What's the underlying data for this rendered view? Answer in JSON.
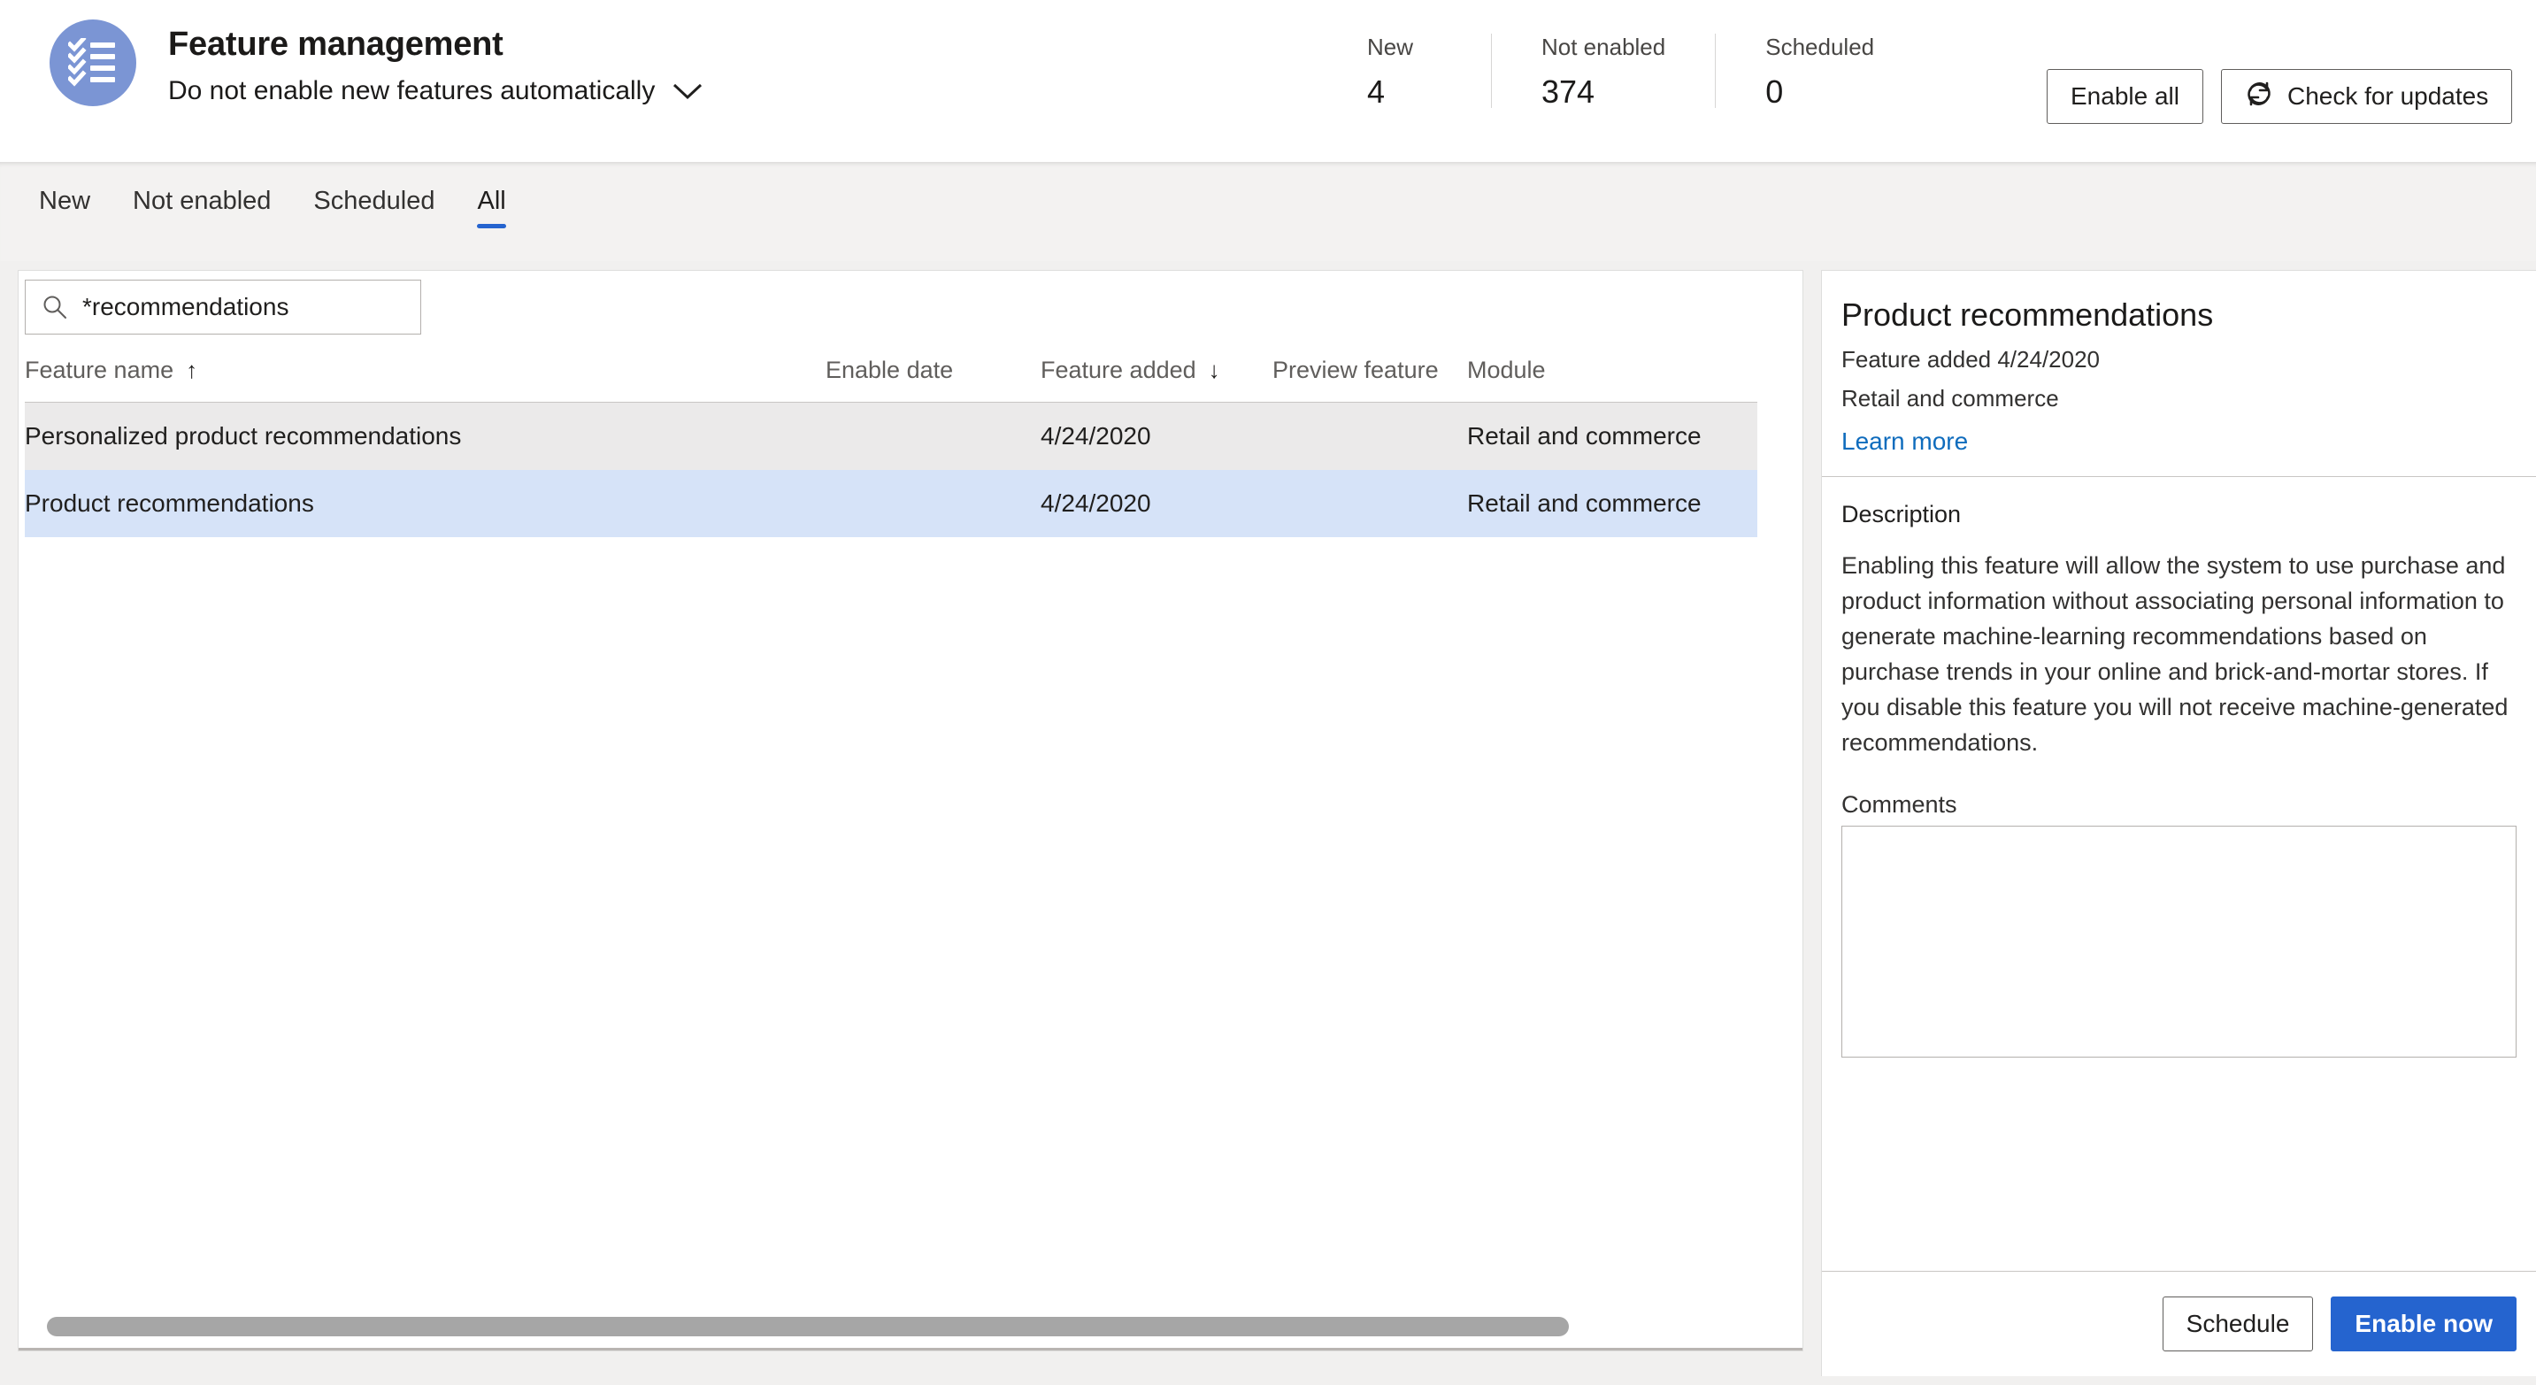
{
  "header": {
    "app_icon": "checklist-icon",
    "title": "Feature management",
    "subtitle": "Do not enable new features automatically",
    "subtitle_chevron": "chevron-down-icon",
    "stats": [
      {
        "label": "New",
        "value": "4"
      },
      {
        "label": "Not enabled",
        "value": "374"
      },
      {
        "label": "Scheduled",
        "value": "0"
      }
    ],
    "actions": {
      "enable_all": "Enable all",
      "check_for_updates": "Check for updates",
      "check_for_updates_icon": "refresh-icon"
    }
  },
  "tabs": [
    {
      "label": "New",
      "selected": false
    },
    {
      "label": "Not enabled",
      "selected": false
    },
    {
      "label": "Scheduled",
      "selected": false
    },
    {
      "label": "All",
      "selected": true
    }
  ],
  "search": {
    "icon": "search-icon",
    "value": "*recommendations"
  },
  "grid": {
    "columns": [
      {
        "label": "Feature name",
        "sort": "↑"
      },
      {
        "label": "Enable date",
        "sort": ""
      },
      {
        "label": "Feature added",
        "sort": "↓"
      },
      {
        "label": "Preview feature",
        "sort": ""
      },
      {
        "label": "Module",
        "sort": ""
      }
    ],
    "rows": [
      {
        "feature_name": "Personalized product recommendations",
        "enable_date": "",
        "feature_added": "4/24/2020",
        "preview_feature": "",
        "module": "Retail and commerce",
        "state": "hover"
      },
      {
        "feature_name": "Product recommendations",
        "enable_date": "",
        "feature_added": "4/24/2020",
        "preview_feature": "",
        "module": "Retail and commerce",
        "state": "selected"
      }
    ]
  },
  "detail": {
    "title": "Product recommendations",
    "feature_added": "Feature added 4/24/2020",
    "module": "Retail and commerce",
    "learn_more": "Learn more",
    "description_label": "Description",
    "description": "Enabling this feature will allow the system to use purchase and product information without associating personal information to generate machine-learning recommendations based on purchase trends in your online and brick-and-mortar stores. If you disable this feature you will not receive machine-generated recommendations.",
    "comments_label": "Comments",
    "comments_value": "",
    "schedule_label": "Schedule",
    "enable_now_label": "Enable now"
  },
  "colors": {
    "accent": "#2564cf",
    "link": "#0f6cbd",
    "icon_bg": "#7b95d4",
    "row_selected": "#d6e3f8",
    "row_hover": "#ebeaea"
  }
}
